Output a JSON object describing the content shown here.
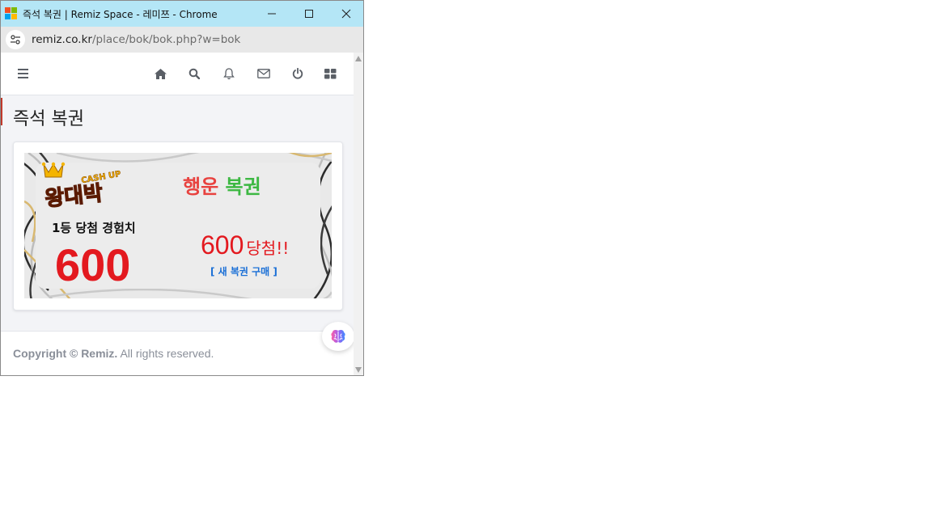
{
  "window": {
    "title": "즉석 복권 | Remiz Space - 레미쯔 - Chrome",
    "minimize_icon": "minimize-icon",
    "maximize_icon": "maximize-icon",
    "close_icon": "close-icon"
  },
  "address": {
    "domain": "remiz.co.kr",
    "path": "/place/bok/bok.php?w=bok"
  },
  "nav": {
    "icons": [
      "menu-icon",
      "home-icon",
      "search-icon",
      "bell-icon",
      "mail-icon",
      "power-icon",
      "grid-icon"
    ]
  },
  "page": {
    "title": "즉석 복권"
  },
  "ticket": {
    "brand_main": "왕대박",
    "brand_tag": "CASH UP",
    "headline_parts": [
      "행운",
      " 복권"
    ],
    "headline_colors": [
      "#e8423f",
      "#3db843"
    ],
    "first_prize_label": "1등 당첨 경험치",
    "first_prize_value": "600",
    "result_value": "600",
    "result_suffix": "당첨!!",
    "buy_link": "[ 새 복권 구매 ]",
    "colors": {
      "red": "#e3191f",
      "blue": "#1a6fd6",
      "bg": "#ececec"
    }
  },
  "footer": {
    "brand": "Copyright © Remiz.",
    "rest": " All rights reserved."
  },
  "floating": {
    "icon": "brain-icon"
  }
}
